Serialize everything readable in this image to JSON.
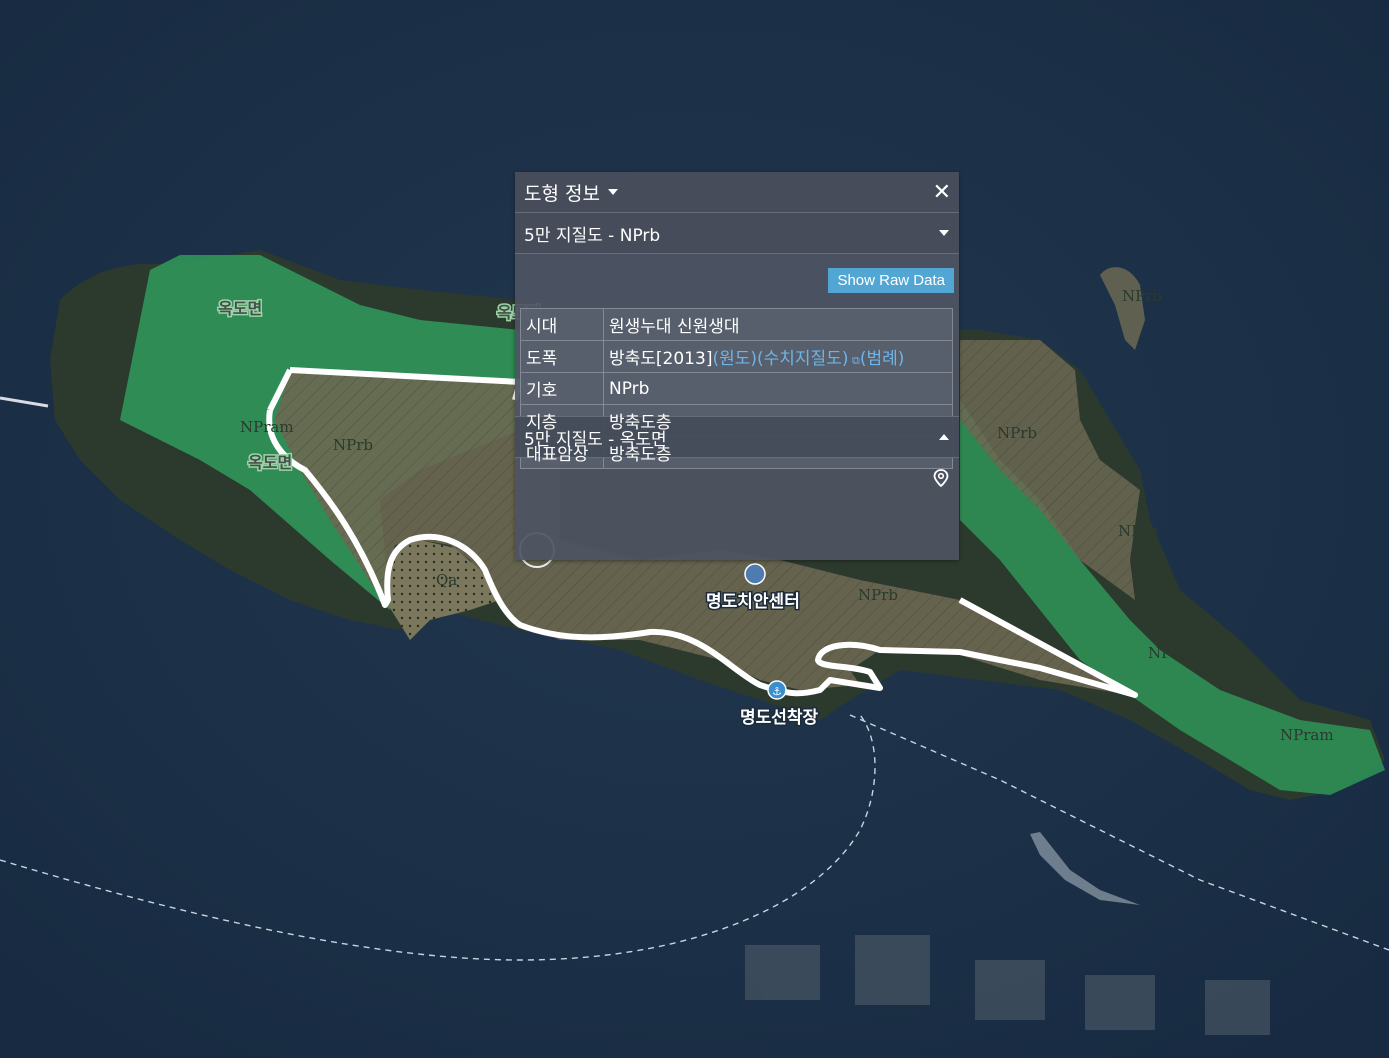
{
  "panel": {
    "title": "도형 정보",
    "section1_title": "5만 지질도 - NPrb",
    "raw_button": "Show Raw Data",
    "rows": [
      {
        "key": "시대",
        "value": "원생누대 신원생대"
      },
      {
        "key": "도폭",
        "value": "방축도[2013]",
        "links": [
          "(원도)",
          "(수치지질도)",
          "(범례)"
        ]
      },
      {
        "key": "기호",
        "value": "NPrb"
      },
      {
        "key": "지층",
        "value": "방축도층"
      },
      {
        "key": "대표암상",
        "value": "방축도층"
      }
    ],
    "section2_title": "5만 지질도 - 옥도면"
  },
  "map": {
    "labels": {
      "okdo1": "옥도면",
      "okdo2": "옥도면",
      "okdo3": "옥도면",
      "nprb_w": "NPrb",
      "nprb_c": "NPrb",
      "nprb_e": "NPrb",
      "nprb_ne": "NPrb",
      "nprb_e2": "NPrb",
      "npram_w": "NPram",
      "npram_e": "NPram",
      "npram_se": "NPram",
      "qa": "Qa",
      "police": "명도치안센터",
      "dock": "명도선착장"
    },
    "colors": {
      "sea": "#1b2f47",
      "green": "#2f9b5a",
      "brown": "#6b6852",
      "outline": "#ffffff"
    }
  }
}
